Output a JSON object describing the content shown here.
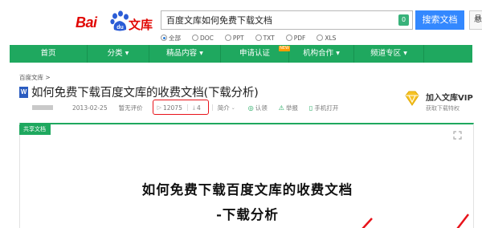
{
  "header": {
    "logo": {
      "bai": "Bai",
      "du": "du",
      "wenku": "文库"
    },
    "search": {
      "value": "百度文库如何免费下载文档",
      "badge": "0"
    },
    "search_button": "搜索文档",
    "extra_button": "悬",
    "filters": [
      {
        "label": "全部",
        "checked": true
      },
      {
        "label": "DOC",
        "checked": false
      },
      {
        "label": "PPT",
        "checked": false
      },
      {
        "label": "TXT",
        "checked": false
      },
      {
        "label": "PDF",
        "checked": false
      },
      {
        "label": "XLS",
        "checked": false
      }
    ]
  },
  "nav": {
    "items": [
      {
        "label": "首页",
        "caret": false
      },
      {
        "label": "分类",
        "caret": true
      },
      {
        "label": "精品内容",
        "caret": true
      },
      {
        "label": "申请认证",
        "caret": false,
        "hot": "NEW"
      },
      {
        "label": "机构合作",
        "caret": true
      },
      {
        "label": "频道专区",
        "caret": true
      }
    ]
  },
  "breadcrumb": "百度文库 >",
  "doc": {
    "icon": "W",
    "title": "如何免费下载百度文库的收费文档(下载分析)",
    "date": "2013-02-25",
    "rating": "暂无评价",
    "views": "12075",
    "downloads": "4",
    "summary": "简介",
    "actions": {
      "certify": "认领",
      "report": "举报",
      "mobile": "手机打开"
    }
  },
  "vip": {
    "title": "加入文库VIP",
    "subtitle": "获取下载特权"
  },
  "preview": {
    "tag": "共享文档",
    "heading1": "如何免费下载百度文库的收费文档",
    "heading2": "-下载分析"
  },
  "colors": {
    "brand_red": "#e10602",
    "nav_green": "#1fa85f",
    "search_blue": "#3388ff",
    "highlight_red": "#e8131a"
  }
}
